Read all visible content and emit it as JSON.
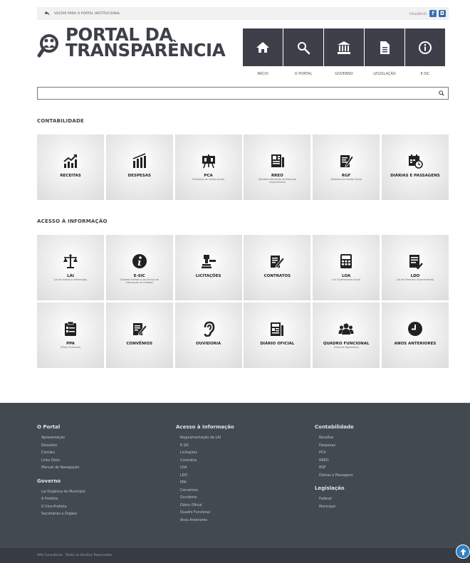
{
  "topbar": {
    "back_label": "VOLTAR PARA O PORTAL INSTITUCIONAL",
    "follow_label": "FOLLOW US:",
    "social": [
      {
        "icon": "facebook-icon",
        "glyph": "f"
      },
      {
        "icon": "instagram-icon",
        "glyph": "◘"
      }
    ]
  },
  "header": {
    "logo_line1": "PORTAL DA",
    "logo_line2": "TRANSPARÊNCIA",
    "nav": [
      {
        "label": "INÍCIO",
        "icon": "home-icon"
      },
      {
        "label": "O PORTAL",
        "icon": "search-icon"
      },
      {
        "label": "GOVERNO",
        "icon": "government-building-icon"
      },
      {
        "label": "LEGISLAÇÃO",
        "icon": "document-icon"
      },
      {
        "label": "E-SIC",
        "icon": "info-icon"
      }
    ]
  },
  "search": {
    "placeholder": "",
    "value": ""
  },
  "sections": {
    "contabilidade": {
      "title": "CONTABILIDADE",
      "tiles": [
        {
          "label": "RECEITAS",
          "sub": "",
          "icon": "chart-up-icon"
        },
        {
          "label": "DESPESAS",
          "sub": "",
          "icon": "chart-bars-down-icon"
        },
        {
          "label": "PCA",
          "sub": "(Prestação de Contas Anual)",
          "icon": "presentation-board-icon"
        },
        {
          "label": "RREO",
          "sub": "(Relatório Resumido da Execução Orçamentária)",
          "icon": "report-icon"
        },
        {
          "label": "RGF",
          "sub": "(Relatório de Gestão Fiscal)",
          "icon": "edit-document-icon"
        },
        {
          "label": "DIÁRIAS E PASSAGENS",
          "sub": "",
          "icon": "calendar-clock-icon"
        }
      ]
    },
    "acesso": {
      "title": "ACESSO À INFORMAÇÃO",
      "tiles": [
        {
          "label": "LAI",
          "sub": "(Lei de Acesso à Informação)",
          "icon": "scale-icon"
        },
        {
          "label": "E-SIC",
          "sub": "(Sistema Eletrônico do Serviço de Informação ao Cidadão)",
          "icon": "info-circle-icon"
        },
        {
          "label": "LICITAÇÕES",
          "sub": "",
          "icon": "gavel-icon"
        },
        {
          "label": "CONTRATOS",
          "sub": "",
          "icon": "contract-pen-icon"
        },
        {
          "label": "LOA",
          "sub": "(Lei Orçamentária Anual)",
          "icon": "calculator-icon"
        },
        {
          "label": "LDO",
          "sub": "(Lei de Diretrizes Orçamentárias)",
          "icon": "list-document-icon"
        },
        {
          "label": "PPA",
          "sub": "(Plano Plurianual)",
          "icon": "clipboard-icon"
        },
        {
          "label": "CONVÊNIOS",
          "sub": "",
          "icon": "contract-edit-icon"
        },
        {
          "label": "OUVIDORIA",
          "sub": "",
          "icon": "ear-icon"
        },
        {
          "label": "DIÁRIO OFICIAL",
          "sub": "",
          "icon": "newspaper-icon"
        },
        {
          "label": "QUADRO FUNCIONAL",
          "sub": "(Folha de Pagamento)",
          "icon": "users-icon"
        },
        {
          "label": "ANOS ANTERIORES",
          "sub": "",
          "icon": "clock-icon"
        }
      ]
    }
  },
  "footer": {
    "columns": [
      {
        "groups": [
          {
            "title": "O Portal",
            "links": [
              "Apresentação",
              "Glossário",
              "Contato",
              "Links Úteis",
              "Manual de Navegação"
            ]
          },
          {
            "title": "Governo",
            "links": [
              "Lei Orgânica do Município",
              "A Prefeita",
              "O Vice-Prefeito",
              "Secretarias e Órgãos"
            ]
          }
        ]
      },
      {
        "groups": [
          {
            "title": "Acesso à Informação",
            "links": [
              "Regulamentação da LAI",
              "E-SIC",
              "Licitações",
              "Contratos",
              "LOA",
              "LDO",
              "PPA",
              "Convênios",
              "Ouvidoria",
              "Diário Oficial",
              "Quadro Funcional",
              "Anos Anteriores"
            ]
          }
        ]
      },
      {
        "groups": [
          {
            "title": "Contabilidade",
            "links": [
              "Receitas",
              "Despesas",
              "PCA",
              "RREO",
              "RGF",
              "Diárias e Passagens"
            ]
          },
          {
            "title": "Legislação",
            "links": [
              "Federal",
              "Municipal"
            ]
          }
        ]
      }
    ],
    "copyright": "Alfa Consultoria - Todos os Direitos Reservados"
  },
  "colors": {
    "dark": "#3d4049",
    "footer_bg": "#424a50",
    "footer_bottom": "#363c41",
    "footer_heading": "#d7e6f0",
    "accent": "#2f80c0"
  }
}
